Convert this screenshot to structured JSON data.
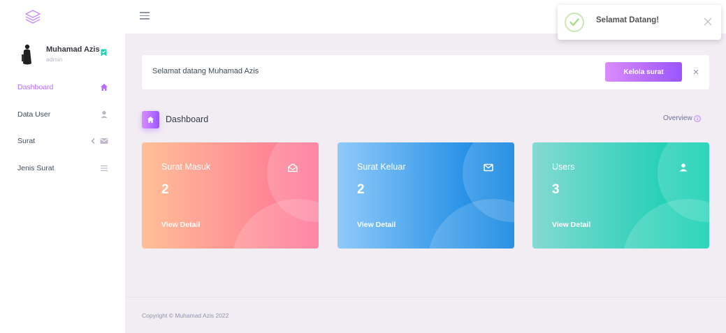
{
  "sidebar": {
    "logo_icon": "layers-icon",
    "profile": {
      "name": "Muhamad Azis",
      "role": "admin",
      "badge_icon": "bookmark-icon"
    },
    "items": [
      {
        "label": "Dashboard",
        "icon": "home-icon",
        "active": true
      },
      {
        "label": "Data User",
        "icon": "user-icon",
        "active": false
      },
      {
        "label": "Surat",
        "icon": "envelope-icon",
        "expand_icon": "chevron-left-icon",
        "active": false
      },
      {
        "label": "Jenis Surat",
        "icon": "list-icon",
        "active": false
      }
    ],
    "accent_color": "#b66dff"
  },
  "topbar": {
    "menu_icon": "hamburger-icon"
  },
  "toast": {
    "title": "Selamat Datang!",
    "icon": "check-circle-icon",
    "close_icon": "close-icon"
  },
  "welcome": {
    "text": "Selamat datang Muhamad Azis",
    "button_label": "Kelola surat",
    "close_icon": "close-icon"
  },
  "page": {
    "title": "Dashboard",
    "icon": "home-icon",
    "overview_label": "Overview",
    "overview_icon": "info-circle-icon"
  },
  "cards": [
    {
      "title": "Surat Masuk",
      "value": "2",
      "link": "View Detail",
      "icon": "envelope-open-icon",
      "gradient": [
        "#ffbf96",
        "#fe7096"
      ]
    },
    {
      "title": "Surat Keluar",
      "value": "2",
      "link": "View Detail",
      "icon": "envelope-icon",
      "gradient": [
        "#90caf9",
        "#047edf"
      ]
    },
    {
      "title": "Users",
      "value": "3",
      "link": "View Detail",
      "icon": "user-icon",
      "gradient": [
        "#84d9d2",
        "#07cdae"
      ]
    }
  ],
  "footer": {
    "copyright": "Copyright © Muhamad Azis 2022"
  }
}
